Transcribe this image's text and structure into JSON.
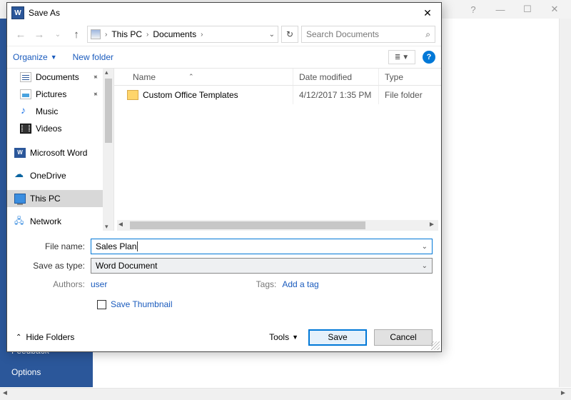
{
  "backdrop": {
    "help_icon": "?",
    "side_items": {
      "feedback": "Feedback",
      "options": "Options"
    }
  },
  "dialog": {
    "title": "Save As",
    "breadcrumb": {
      "root": "This PC",
      "folder": "Documents"
    },
    "search_placeholder": "Search Documents",
    "toolbar": {
      "organize": "Organize",
      "newfolder": "New folder"
    },
    "tree": {
      "documents": "Documents",
      "pictures": "Pictures",
      "music": "Music",
      "videos": "Videos",
      "word": "Microsoft Word",
      "onedrive": "OneDrive",
      "thispc": "This PC",
      "network": "Network"
    },
    "columns": {
      "name": "Name",
      "date": "Date modified",
      "type": "Type"
    },
    "rows": [
      {
        "name": "Custom Office Templates",
        "date": "4/12/2017 1:35 PM",
        "type": "File folder"
      }
    ],
    "form": {
      "filename_label": "File name:",
      "filename_value": "Sales Plan",
      "type_label": "Save as type:",
      "type_value": "Word Document",
      "authors_label": "Authors:",
      "authors_value": "user",
      "tags_label": "Tags:",
      "tags_value": "Add a tag",
      "thumbnail": "Save Thumbnail"
    },
    "footer": {
      "hide": "Hide Folders",
      "tools": "Tools",
      "save": "Save",
      "cancel": "Cancel"
    }
  }
}
